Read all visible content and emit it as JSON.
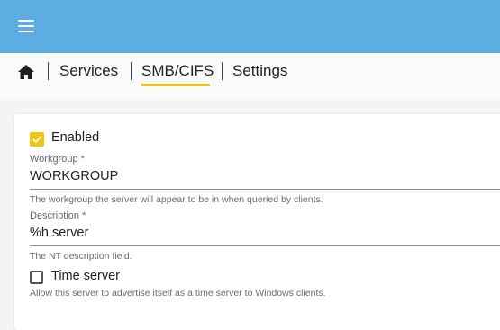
{
  "header": {
    "menu_icon": "hamburger-menu-icon",
    "color": "#5dade2"
  },
  "breadcrumb": {
    "home_icon": "home-icon",
    "items": [
      "Services",
      "SMB/CIFS",
      "Settings"
    ],
    "active_color": "#f1c40f"
  },
  "form": {
    "enabled": {
      "label": "Enabled",
      "checked": true
    },
    "workgroup": {
      "label": "Workgroup *",
      "value": "WORKGROUP",
      "hint": "The workgroup the server will appear to be in when queried by clients."
    },
    "description": {
      "label": "Description *",
      "value": "%h server",
      "hint": "The NT description field."
    },
    "time_server": {
      "label": "Time server",
      "checked": false,
      "hint": "Allow this server to advertise itself as a time server to Windows clients."
    }
  }
}
